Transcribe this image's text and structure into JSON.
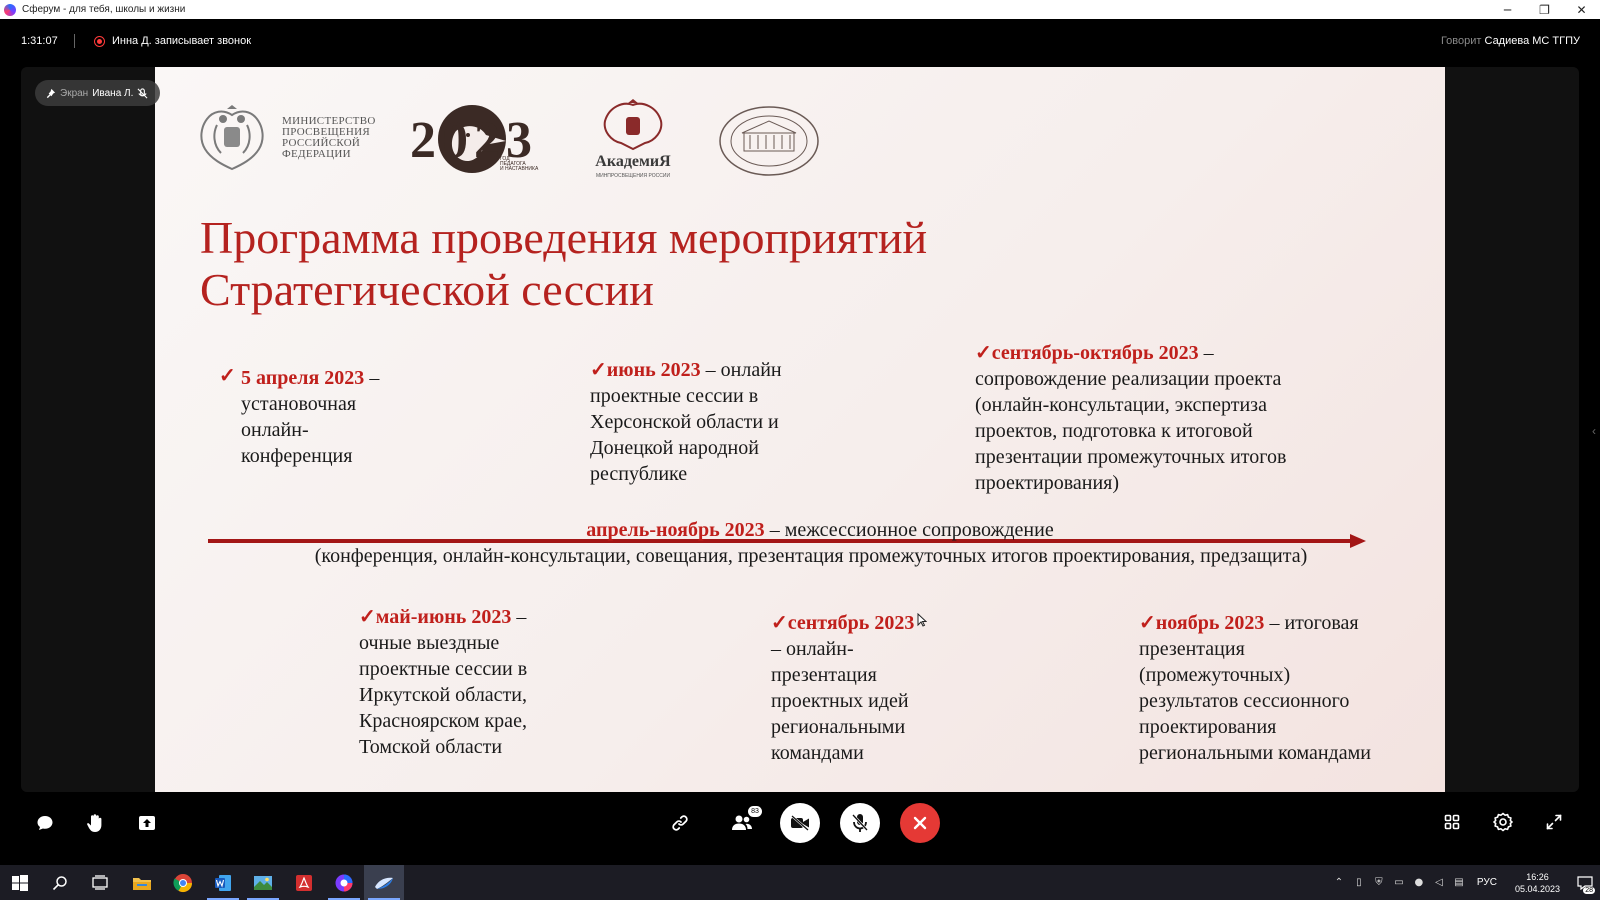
{
  "window": {
    "title": "Сферум - для тебя, школы и жизни",
    "minimize": "─",
    "restore": "❐",
    "close": "✕"
  },
  "call": {
    "duration": "1:31:07",
    "recording_text": "Инна Д. записывает звонок",
    "speaking_label": "Говорит",
    "speaking_name": "Садиева МС ТГПУ",
    "screen_badge_label": "Экран",
    "screen_badge_name": "Ивана Л."
  },
  "slide": {
    "logo_ministry_text": [
      "МИНИСТЕРСТВО",
      "ПРОСВЕЩЕНИЯ",
      "РОССИЙСКОЙ",
      "ФЕДЕРАЦИИ"
    ],
    "logo_2023_big": "2023",
    "logo_2023_small": [
      "ГОД",
      "ПЕДАГОГА",
      "И НАСТАВНИКА"
    ],
    "logo_academy_word": "АкадемиЯ",
    "logo_academy_sub": "МИНПРОСВЕЩЕНИЯ РОССИИ",
    "title_line1": "Программа проведения мероприятий",
    "title_line2": "Стратегической сессии",
    "blocks": [
      {
        "date": "5 апреля 2023",
        "text_lines": [
          "установочная",
          "онлайн-",
          "конференция"
        ]
      },
      {
        "date": "июнь 2023",
        "after_date": "– онлайн",
        "text_lines": [
          "проектные сессии в",
          "Херсонской области и",
          "Донецкой народной",
          "республике"
        ]
      },
      {
        "date": "сентябрь-октябрь 2023",
        "after_date": "–",
        "text_lines": [
          "сопровождение реализации проекта",
          "(онлайн-консультации, экспертиза",
          "проектов, подготовка к итоговой",
          "презентации промежуточных итогов",
          "проектирования)"
        ]
      },
      {
        "date": "май-июнь 2023",
        "after_date": "–",
        "text_lines": [
          "очные выездные",
          "проектные сессии в",
          "Иркутской области,",
          "Красноярском крае,",
          "Томской области"
        ]
      },
      {
        "date": "сентябрь 2023",
        "after_date": "",
        "text_lines": [
          "– онлайн-",
          "презентация",
          "проектных идей",
          "региональными",
          "командами"
        ]
      },
      {
        "date": "ноябрь 2023",
        "after_date": "– итоговая",
        "text_lines": [
          "презентация",
          "(промежуточных)",
          "результатов сессионного",
          "проектирования",
          "региональными командами"
        ]
      }
    ],
    "timeline_date": "апрель-ноябрь 2023",
    "timeline_text": "– межсессионное сопровождение",
    "timeline_sub": "(конференция, онлайн-консультации, совещания, презентация промежуточных итогов проектирования, предзащита)",
    "check": "✓",
    "first_dash": "–"
  },
  "controls": {
    "participants_count": "83"
  },
  "taskbar": {
    "lang": "РУС",
    "time": "16:26",
    "date": "05.04.2023",
    "notifications": "28"
  },
  "colors": {
    "accent_red": "#c0201c",
    "title_red": "#b5221f",
    "end_call": "#e53935"
  }
}
